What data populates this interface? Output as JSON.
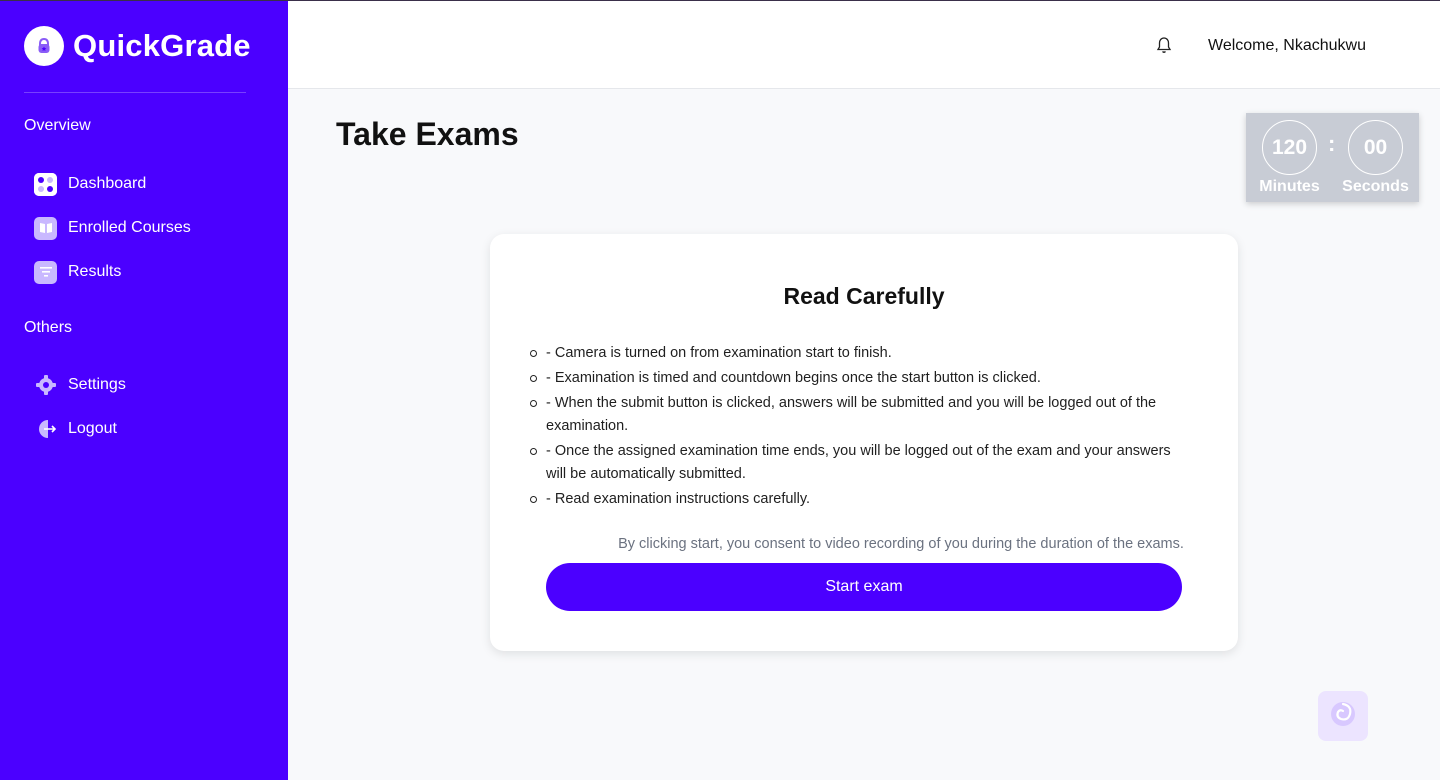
{
  "app": {
    "name": "QuickGrade"
  },
  "sidebar": {
    "sections": [
      {
        "label": "Overview",
        "items": [
          {
            "label": "Dashboard",
            "icon": "dashboard-icon"
          },
          {
            "label": "Enrolled Courses",
            "icon": "book-icon"
          },
          {
            "label": "Results",
            "icon": "results-list-icon"
          }
        ]
      },
      {
        "label": "Others",
        "items": [
          {
            "label": "Settings",
            "icon": "gear-icon"
          },
          {
            "label": "Logout",
            "icon": "logout-icon"
          }
        ]
      }
    ]
  },
  "header": {
    "welcome": "Welcome, Nkachukwu",
    "icon": "bell-icon"
  },
  "page": {
    "title": "Take Exams"
  },
  "timer": {
    "minutes": "120",
    "seconds": "00",
    "minutes_label": "Minutes",
    "seconds_label": "Seconds",
    "separator": ":"
  },
  "card": {
    "title": "Read Carefully",
    "rules": [
      "- Camera is turned on from examination start to finish.",
      "- Examination is timed and countdown begins once the start button is clicked.",
      "- When the submit button is clicked, answers will be submitted and you will be logged out of the examination.",
      "- Once the assigned examination time ends, you will be logged out of the exam and your answers will be automatically submitted.",
      "- Read examination instructions carefully."
    ],
    "consent": "By clicking start, you consent to video recording of you during the duration of the exams.",
    "start_label": "Start exam"
  },
  "colors": {
    "brand": "#4b00ff",
    "background": "#f8f9fb",
    "timer_bg": "#c8ccd5"
  },
  "float_button": {
    "icon": "spiral-icon"
  }
}
